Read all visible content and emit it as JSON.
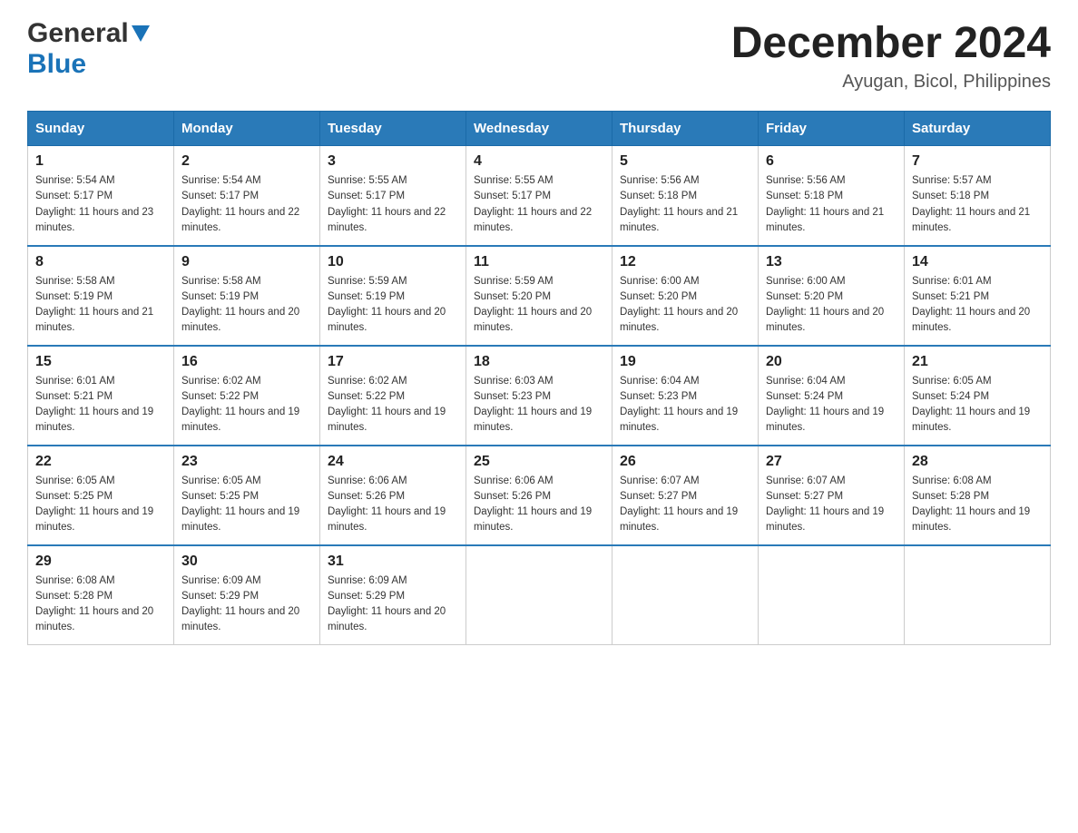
{
  "header": {
    "logo_general": "General",
    "logo_blue": "Blue",
    "month_title": "December 2024",
    "location": "Ayugan, Bicol, Philippines"
  },
  "days_of_week": [
    "Sunday",
    "Monday",
    "Tuesday",
    "Wednesday",
    "Thursday",
    "Friday",
    "Saturday"
  ],
  "weeks": [
    [
      {
        "day": "1",
        "sunrise": "5:54 AM",
        "sunset": "5:17 PM",
        "daylight": "11 hours and 23 minutes."
      },
      {
        "day": "2",
        "sunrise": "5:54 AM",
        "sunset": "5:17 PM",
        "daylight": "11 hours and 22 minutes."
      },
      {
        "day": "3",
        "sunrise": "5:55 AM",
        "sunset": "5:17 PM",
        "daylight": "11 hours and 22 minutes."
      },
      {
        "day": "4",
        "sunrise": "5:55 AM",
        "sunset": "5:17 PM",
        "daylight": "11 hours and 22 minutes."
      },
      {
        "day": "5",
        "sunrise": "5:56 AM",
        "sunset": "5:18 PM",
        "daylight": "11 hours and 21 minutes."
      },
      {
        "day": "6",
        "sunrise": "5:56 AM",
        "sunset": "5:18 PM",
        "daylight": "11 hours and 21 minutes."
      },
      {
        "day": "7",
        "sunrise": "5:57 AM",
        "sunset": "5:18 PM",
        "daylight": "11 hours and 21 minutes."
      }
    ],
    [
      {
        "day": "8",
        "sunrise": "5:58 AM",
        "sunset": "5:19 PM",
        "daylight": "11 hours and 21 minutes."
      },
      {
        "day": "9",
        "sunrise": "5:58 AM",
        "sunset": "5:19 PM",
        "daylight": "11 hours and 20 minutes."
      },
      {
        "day": "10",
        "sunrise": "5:59 AM",
        "sunset": "5:19 PM",
        "daylight": "11 hours and 20 minutes."
      },
      {
        "day": "11",
        "sunrise": "5:59 AM",
        "sunset": "5:20 PM",
        "daylight": "11 hours and 20 minutes."
      },
      {
        "day": "12",
        "sunrise": "6:00 AM",
        "sunset": "5:20 PM",
        "daylight": "11 hours and 20 minutes."
      },
      {
        "day": "13",
        "sunrise": "6:00 AM",
        "sunset": "5:20 PM",
        "daylight": "11 hours and 20 minutes."
      },
      {
        "day": "14",
        "sunrise": "6:01 AM",
        "sunset": "5:21 PM",
        "daylight": "11 hours and 20 minutes."
      }
    ],
    [
      {
        "day": "15",
        "sunrise": "6:01 AM",
        "sunset": "5:21 PM",
        "daylight": "11 hours and 19 minutes."
      },
      {
        "day": "16",
        "sunrise": "6:02 AM",
        "sunset": "5:22 PM",
        "daylight": "11 hours and 19 minutes."
      },
      {
        "day": "17",
        "sunrise": "6:02 AM",
        "sunset": "5:22 PM",
        "daylight": "11 hours and 19 minutes."
      },
      {
        "day": "18",
        "sunrise": "6:03 AM",
        "sunset": "5:23 PM",
        "daylight": "11 hours and 19 minutes."
      },
      {
        "day": "19",
        "sunrise": "6:04 AM",
        "sunset": "5:23 PM",
        "daylight": "11 hours and 19 minutes."
      },
      {
        "day": "20",
        "sunrise": "6:04 AM",
        "sunset": "5:24 PM",
        "daylight": "11 hours and 19 minutes."
      },
      {
        "day": "21",
        "sunrise": "6:05 AM",
        "sunset": "5:24 PM",
        "daylight": "11 hours and 19 minutes."
      }
    ],
    [
      {
        "day": "22",
        "sunrise": "6:05 AM",
        "sunset": "5:25 PM",
        "daylight": "11 hours and 19 minutes."
      },
      {
        "day": "23",
        "sunrise": "6:05 AM",
        "sunset": "5:25 PM",
        "daylight": "11 hours and 19 minutes."
      },
      {
        "day": "24",
        "sunrise": "6:06 AM",
        "sunset": "5:26 PM",
        "daylight": "11 hours and 19 minutes."
      },
      {
        "day": "25",
        "sunrise": "6:06 AM",
        "sunset": "5:26 PM",
        "daylight": "11 hours and 19 minutes."
      },
      {
        "day": "26",
        "sunrise": "6:07 AM",
        "sunset": "5:27 PM",
        "daylight": "11 hours and 19 minutes."
      },
      {
        "day": "27",
        "sunrise": "6:07 AM",
        "sunset": "5:27 PM",
        "daylight": "11 hours and 19 minutes."
      },
      {
        "day": "28",
        "sunrise": "6:08 AM",
        "sunset": "5:28 PM",
        "daylight": "11 hours and 19 minutes."
      }
    ],
    [
      {
        "day": "29",
        "sunrise": "6:08 AM",
        "sunset": "5:28 PM",
        "daylight": "11 hours and 20 minutes."
      },
      {
        "day": "30",
        "sunrise": "6:09 AM",
        "sunset": "5:29 PM",
        "daylight": "11 hours and 20 minutes."
      },
      {
        "day": "31",
        "sunrise": "6:09 AM",
        "sunset": "5:29 PM",
        "daylight": "11 hours and 20 minutes."
      },
      null,
      null,
      null,
      null
    ]
  ],
  "labels": {
    "sunrise_prefix": "Sunrise: ",
    "sunset_prefix": "Sunset: ",
    "daylight_prefix": "Daylight: "
  }
}
